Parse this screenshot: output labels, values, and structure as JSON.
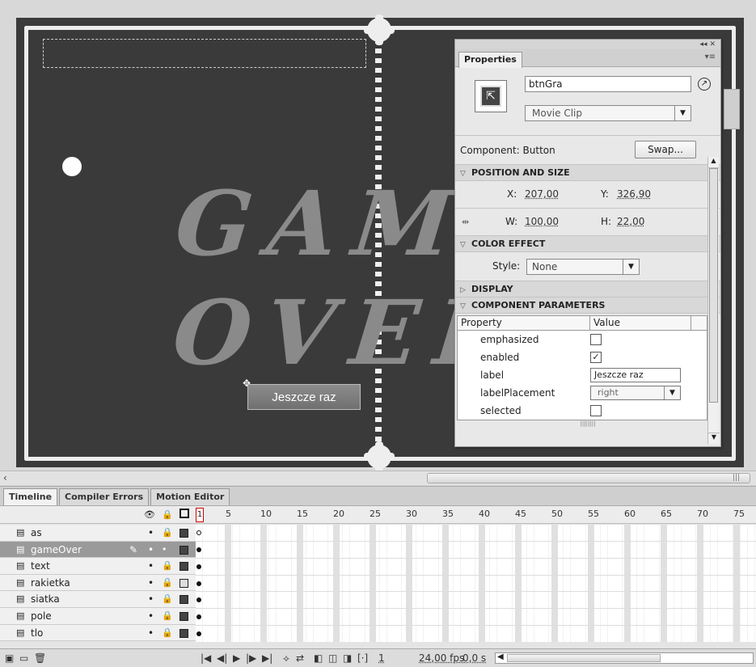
{
  "stage": {
    "game_over_line1": "GAME",
    "game_over_line2": "OVER",
    "button_label": "Jeszcze raz"
  },
  "properties": {
    "tab": "Properties",
    "instance_name": "btnGra",
    "symbol_type": "Movie Clip",
    "component_label": "Component:",
    "component_value": "Button",
    "swap_label": "Swap...",
    "sections": {
      "position_size": "POSITION AND SIZE",
      "color_effect": "COLOR EFFECT",
      "display": "DISPLAY",
      "component_params": "COMPONENT PARAMETERS"
    },
    "x_label": "X:",
    "x_value": "207,00",
    "y_label": "Y:",
    "y_value": "326,90",
    "w_label": "W:",
    "w_value": "100,00",
    "h_label": "H:",
    "h_value": "22,00",
    "style_label": "Style:",
    "style_value": "None",
    "params_header": {
      "property": "Property",
      "value": "Value"
    },
    "params": [
      {
        "name": "emphasized",
        "kind": "checkbox",
        "checked": false
      },
      {
        "name": "enabled",
        "kind": "checkbox",
        "checked": true
      },
      {
        "name": "label",
        "kind": "text",
        "value": "Jeszcze raz"
      },
      {
        "name": "labelPlacement",
        "kind": "select",
        "value": "right"
      },
      {
        "name": "selected",
        "kind": "checkbox",
        "checked": false
      }
    ]
  },
  "timeline": {
    "tabs": [
      "Timeline",
      "Compiler Errors",
      "Motion Editor"
    ],
    "ruler": [
      "1",
      "5",
      "10",
      "15",
      "20",
      "25",
      "30",
      "35",
      "40",
      "45",
      "50",
      "55",
      "60",
      "65",
      "70",
      "75"
    ],
    "layers": [
      {
        "name": "as",
        "selected": false
      },
      {
        "name": "gameOver",
        "selected": true
      },
      {
        "name": "text",
        "selected": false
      },
      {
        "name": "rakietka",
        "selected": false
      },
      {
        "name": "siatka",
        "selected": false
      },
      {
        "name": "pole",
        "selected": false
      },
      {
        "name": "tlo",
        "selected": false
      }
    ],
    "current_frame": "1",
    "fps": "24,00 fps",
    "time": "0,0 s"
  }
}
